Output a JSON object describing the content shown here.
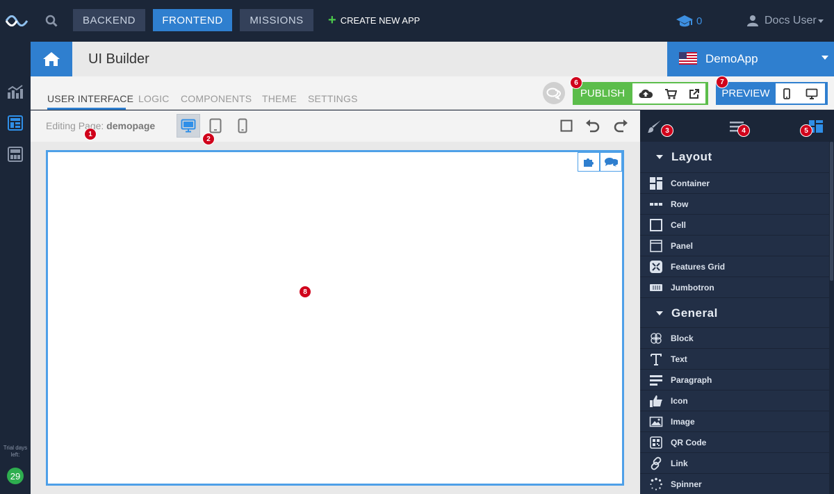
{
  "topbar": {
    "nav": [
      "BACKEND",
      "FRONTEND",
      "MISSIONS"
    ],
    "create_app": "CREATE NEW APP",
    "edu_count": "0",
    "user_name": "Docs User"
  },
  "sidebar": {
    "trial_label": "Trial days left:",
    "trial_days": "29"
  },
  "header": {
    "title": "UI Builder",
    "app_name": "DemoApp"
  },
  "tabs": [
    "USER INTERFACE",
    "LOGIC",
    "COMPONENTS",
    "THEME",
    "SETTINGS"
  ],
  "actions": {
    "publish": "PUBLISH",
    "preview": "PREVIEW"
  },
  "editor": {
    "editing_label": "Editing Page: ",
    "page_name": "demopage"
  },
  "badges": [
    "1",
    "2",
    "3",
    "4",
    "5",
    "6",
    "7",
    "8"
  ],
  "panel": {
    "sections": [
      {
        "title": "Layout",
        "items": [
          "Container",
          "Row",
          "Cell",
          "Panel",
          "Features Grid",
          "Jumbotron"
        ]
      },
      {
        "title": "General",
        "items": [
          "Block",
          "Text",
          "Paragraph",
          "Icon",
          "Image",
          "QR Code",
          "Link",
          "Spinner"
        ]
      }
    ]
  },
  "colors": {
    "accent": "#2f7fcf",
    "publish": "#5cbd4b",
    "badge": "#d0021b",
    "dark_bg": "#1b2638"
  }
}
